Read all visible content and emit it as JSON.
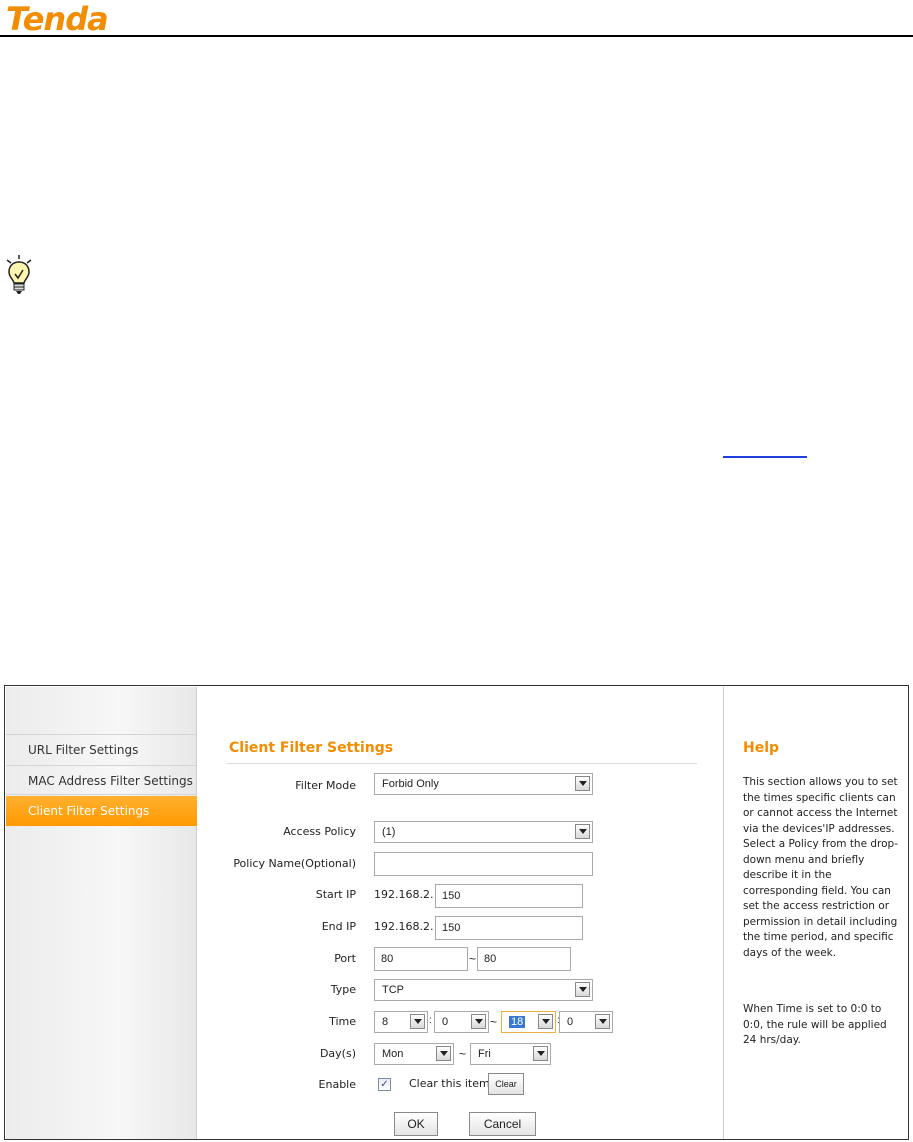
{
  "logo_text": "Tenda",
  "sidebar": {
    "items": [
      {
        "label": "URL Filter Settings"
      },
      {
        "label": "MAC Address Filter Settings"
      },
      {
        "label": "Client Filter Settings"
      }
    ]
  },
  "main": {
    "title": "Client Filter Settings",
    "filter_mode": {
      "label": "Filter Mode",
      "value": "Forbid Only"
    },
    "access_policy": {
      "label": "Access Policy",
      "value": "(1)"
    },
    "policy_name": {
      "label": "Policy Name(Optional)",
      "value": ""
    },
    "start_ip": {
      "label": "Start IP",
      "prefix": "192.168.2.",
      "value": "150"
    },
    "end_ip": {
      "label": "End IP",
      "prefix": "192.168.2.",
      "value": "150"
    },
    "port": {
      "label": "Port",
      "from": "80",
      "separator": "~",
      "to": "80"
    },
    "type": {
      "label": "Type",
      "value": "TCP"
    },
    "time": {
      "label": "Time",
      "start_hour": "8",
      "colon": ":",
      "start_min": "0",
      "separator": "~",
      "end_hour": "18",
      "end_min": "0"
    },
    "days": {
      "label": "Day(s)",
      "from": "Mon",
      "separator": "~",
      "to": "Fri"
    },
    "enable": {
      "label": "Enable",
      "checked_mark": "✓",
      "clear_label": "Clear this item:",
      "clear_button": "Clear"
    },
    "ok_button": "OK",
    "cancel_button": "Cancel"
  },
  "help": {
    "title": "Help",
    "paragraph1": "This section allows you to set the times specific clients can or cannot access the Internet via the devices'IP addresses. Select a Policy from the drop-down menu and briefly describe it in the corresponding field. You can set the access restriction or permission in detail including the time period, and specific days of the week.",
    "paragraph2": "When Time is set to 0:0 to 0:0, the rule will be applied 24 hrs/day."
  },
  "colors": {
    "brand_orange": "#f28c00",
    "active_tab": "#ff9a00",
    "link_blue": "#1f3fe0"
  }
}
